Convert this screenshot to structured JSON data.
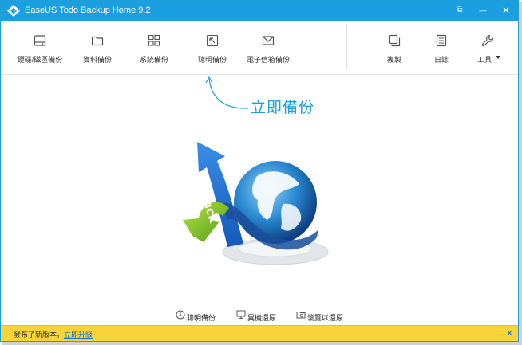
{
  "titlebar": {
    "title": "EaseUS Todo Backup Home 9.2",
    "restore_icon": "⧉",
    "minimize_icon": "—",
    "close_icon": "✕"
  },
  "toolbar": {
    "items": [
      {
        "label": "硬碟/磁區備份",
        "icon": "hard-drive-icon"
      },
      {
        "label": "資料備份",
        "icon": "folder-icon"
      },
      {
        "label": "系統備份",
        "icon": "windows-grid-icon"
      },
      {
        "label": "聰明備份",
        "icon": "smart-arrow-icon"
      },
      {
        "label": "電子信箱備份",
        "icon": "envelope-icon"
      }
    ],
    "right_items": [
      {
        "label": "複製",
        "icon": "clone-icon"
      },
      {
        "label": "日誌",
        "icon": "log-icon"
      },
      {
        "label": "工具",
        "icon": "wrench-icon"
      }
    ]
  },
  "main": {
    "hint": "立即備份",
    "illustration_text": "Back"
  },
  "bottom_links": [
    {
      "label": "聰明備份",
      "icon": "smart-backup-icon"
    },
    {
      "label": "異機還原",
      "icon": "restore-machine-icon"
    },
    {
      "label": "瀏覽以還原",
      "icon": "browse-restore-icon"
    }
  ],
  "notification": {
    "message": "發布了新版本，",
    "link": "立即升級",
    "close": "✕"
  },
  "colors": {
    "accent": "#1a9fe0",
    "notify_bg": "#f9d33a"
  }
}
